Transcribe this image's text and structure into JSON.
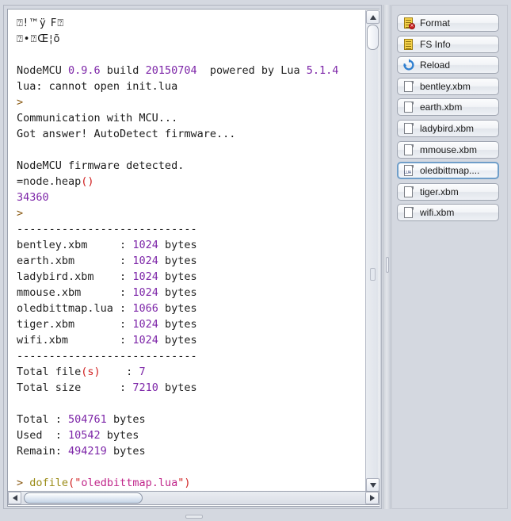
{
  "console": {
    "lines": [
      {
        "type": "garbled",
        "text": "⍰!™ÿ F⍰"
      },
      {
        "type": "garbled",
        "text": "⍰•⍰Œ¦õ"
      },
      {
        "type": "blank",
        "text": ""
      },
      {
        "type": "rich",
        "segments": [
          {
            "text": "NodeMCU ",
            "color": "default"
          },
          {
            "text": "0.9.6",
            "color": "purple"
          },
          {
            "text": " build ",
            "color": "default"
          },
          {
            "text": "20150704",
            "color": "purple"
          },
          {
            "text": "  powered by Lua ",
            "color": "default"
          },
          {
            "text": "5.1.4",
            "color": "purple"
          }
        ]
      },
      {
        "type": "plain",
        "text": "lua: cannot open init.lua"
      },
      {
        "type": "rich",
        "segments": [
          {
            "text": ">",
            "color": "prompt"
          }
        ]
      },
      {
        "type": "plain",
        "text": "Communication with MCU..."
      },
      {
        "type": "plain",
        "text": "Got answer! AutoDetect firmware..."
      },
      {
        "type": "blank",
        "text": ""
      },
      {
        "type": "plain",
        "text": "NodeMCU firmware detected."
      },
      {
        "type": "rich",
        "segments": [
          {
            "text": "=node.heap",
            "color": "default"
          },
          {
            "text": "()",
            "color": "red"
          }
        ]
      },
      {
        "type": "rich",
        "segments": [
          {
            "text": "34360",
            "color": "purple"
          }
        ]
      },
      {
        "type": "rich",
        "segments": [
          {
            "text": ">",
            "color": "prompt"
          }
        ]
      },
      {
        "type": "plain",
        "text": "----------------------------"
      },
      {
        "type": "rich",
        "segments": [
          {
            "text": "bentley.xbm     : ",
            "color": "default"
          },
          {
            "text": "1024",
            "color": "purple"
          },
          {
            "text": " bytes",
            "color": "default"
          }
        ]
      },
      {
        "type": "rich",
        "segments": [
          {
            "text": "earth.xbm       : ",
            "color": "default"
          },
          {
            "text": "1024",
            "color": "purple"
          },
          {
            "text": " bytes",
            "color": "default"
          }
        ]
      },
      {
        "type": "rich",
        "segments": [
          {
            "text": "ladybird.xbm    : ",
            "color": "default"
          },
          {
            "text": "1024",
            "color": "purple"
          },
          {
            "text": " bytes",
            "color": "default"
          }
        ]
      },
      {
        "type": "rich",
        "segments": [
          {
            "text": "mmouse.xbm      : ",
            "color": "default"
          },
          {
            "text": "1024",
            "color": "purple"
          },
          {
            "text": " bytes",
            "color": "default"
          }
        ]
      },
      {
        "type": "rich",
        "segments": [
          {
            "text": "oledbittmap.lua : ",
            "color": "default"
          },
          {
            "text": "1066",
            "color": "purple"
          },
          {
            "text": " bytes",
            "color": "default"
          }
        ]
      },
      {
        "type": "rich",
        "segments": [
          {
            "text": "tiger.xbm       : ",
            "color": "default"
          },
          {
            "text": "1024",
            "color": "purple"
          },
          {
            "text": " bytes",
            "color": "default"
          }
        ]
      },
      {
        "type": "rich",
        "segments": [
          {
            "text": "wifi.xbm        : ",
            "color": "default"
          },
          {
            "text": "1024",
            "color": "purple"
          },
          {
            "text": " bytes",
            "color": "default"
          }
        ]
      },
      {
        "type": "plain",
        "text": "----------------------------"
      },
      {
        "type": "rich",
        "segments": [
          {
            "text": "Total file",
            "color": "default"
          },
          {
            "text": "(s)",
            "color": "red"
          },
          {
            "text": "    : ",
            "color": "default"
          },
          {
            "text": "7",
            "color": "purple"
          }
        ]
      },
      {
        "type": "rich",
        "segments": [
          {
            "text": "Total size      : ",
            "color": "default"
          },
          {
            "text": "7210",
            "color": "purple"
          },
          {
            "text": " bytes",
            "color": "default"
          }
        ]
      },
      {
        "type": "blank",
        "text": ""
      },
      {
        "type": "rich",
        "segments": [
          {
            "text": "Total : ",
            "color": "default"
          },
          {
            "text": "504761",
            "color": "purple"
          },
          {
            "text": " bytes",
            "color": "default"
          }
        ]
      },
      {
        "type": "rich",
        "segments": [
          {
            "text": "Used  : ",
            "color": "default"
          },
          {
            "text": "10542",
            "color": "purple"
          },
          {
            "text": " bytes",
            "color": "default"
          }
        ]
      },
      {
        "type": "rich",
        "segments": [
          {
            "text": "Remain: ",
            "color": "default"
          },
          {
            "text": "494219",
            "color": "purple"
          },
          {
            "text": " bytes",
            "color": "default"
          }
        ]
      },
      {
        "type": "blank",
        "text": ""
      },
      {
        "type": "rich",
        "segments": [
          {
            "text": "> ",
            "color": "prompt"
          },
          {
            "text": "dofile",
            "color": "fn"
          },
          {
            "text": "(",
            "color": "red"
          },
          {
            "text": "\"",
            "color": "red"
          },
          {
            "text": "oledbittmap.lua",
            "color": "str"
          },
          {
            "text": "\"",
            "color": "red"
          },
          {
            "text": ")",
            "color": "red"
          }
        ]
      },
      {
        "type": "rich",
        "highlight": true,
        "segments": [
          {
            "text": ">",
            "color": "prompt"
          }
        ]
      }
    ]
  },
  "sidebar": {
    "buttons": [
      {
        "label": "Format",
        "icon": "format-document-icon",
        "selected": false
      },
      {
        "label": "FS Info",
        "icon": "fs-info-document-icon",
        "selected": false
      },
      {
        "label": "Reload",
        "icon": "reload-icon",
        "selected": false
      },
      {
        "label": "bentley.xbm",
        "icon": "file-icon",
        "selected": false
      },
      {
        "label": "earth.xbm",
        "icon": "file-icon",
        "selected": false
      },
      {
        "label": "ladybird.xbm",
        "icon": "file-icon",
        "selected": false
      },
      {
        "label": "mmouse.xbm",
        "icon": "file-icon",
        "selected": false
      },
      {
        "label": "oledbittmap....",
        "icon": "lua-file-icon",
        "selected": true
      },
      {
        "label": "tiger.xbm",
        "icon": "file-icon",
        "selected": false
      },
      {
        "label": "wifi.xbm",
        "icon": "file-icon",
        "selected": false
      }
    ]
  },
  "scrollbars": {
    "vertical_up": "▲",
    "vertical_down": "▼",
    "horizontal_left": "◀",
    "horizontal_right": "▶"
  },
  "colors": {
    "number": "#7d26a8",
    "string": "#c0268a",
    "punctuation": "#d02020",
    "function": "#9a8b16",
    "prompt": "#8a5a12",
    "highlight_bg": "#f6f3a8",
    "panel_bg": "#d4d8e0",
    "selection_border": "#6f9ec9"
  }
}
